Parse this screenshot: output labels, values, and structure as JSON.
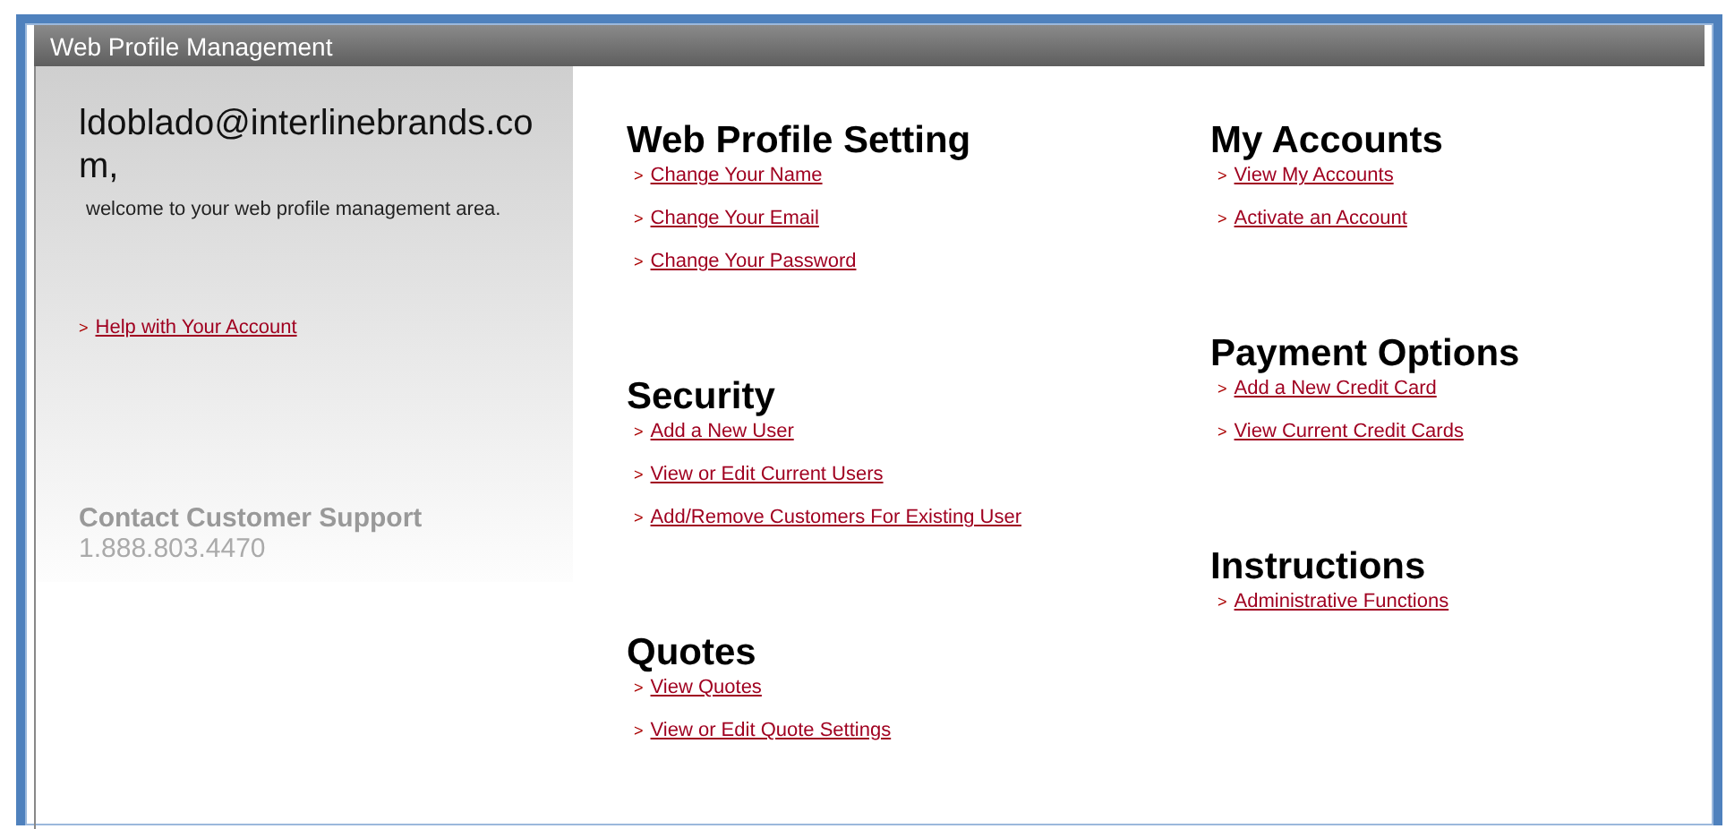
{
  "window": {
    "title": "Web Profile Management"
  },
  "sidebar": {
    "greeting": "ldoblado@interlinebrands.com,",
    "welcome": "welcome to your web profile management area.",
    "links": [
      {
        "marker": ">",
        "label": "Help with Your Account"
      }
    ],
    "support": {
      "heading": "Contact Customer Support",
      "phone": "1.888.803.4470"
    }
  },
  "columns": [
    {
      "sections": [
        {
          "heading": "Web Profile Setting",
          "links": [
            {
              "marker": ">",
              "label": "Change Your Name"
            },
            {
              "marker": ">",
              "label": "Change Your Email"
            },
            {
              "marker": ">",
              "label": "Change Your Password"
            }
          ]
        },
        {
          "heading": "Security",
          "links": [
            {
              "marker": ">",
              "label": "Add a New User"
            },
            {
              "marker": ">",
              "label": "View or Edit Current Users"
            },
            {
              "marker": ">",
              "label": "Add/Remove Customers For Existing User"
            }
          ]
        },
        {
          "heading": "Quotes",
          "links": [
            {
              "marker": ">",
              "label": "View Quotes"
            },
            {
              "marker": ">",
              "label": "View or Edit Quote Settings"
            }
          ]
        }
      ]
    },
    {
      "sections": [
        {
          "heading": "My Accounts",
          "links": [
            {
              "marker": ">",
              "label": "View My Accounts"
            },
            {
              "marker": ">",
              "label": "Activate an Account"
            }
          ]
        },
        {
          "heading": "Payment Options",
          "links": [
            {
              "marker": ">",
              "label": "Add a New Credit Card"
            },
            {
              "marker": ">",
              "label": "View Current Credit Cards"
            }
          ]
        },
        {
          "heading": "Instructions",
          "links": [
            {
              "marker": ">",
              "label": "Administrative Functions"
            }
          ]
        }
      ]
    }
  ]
}
